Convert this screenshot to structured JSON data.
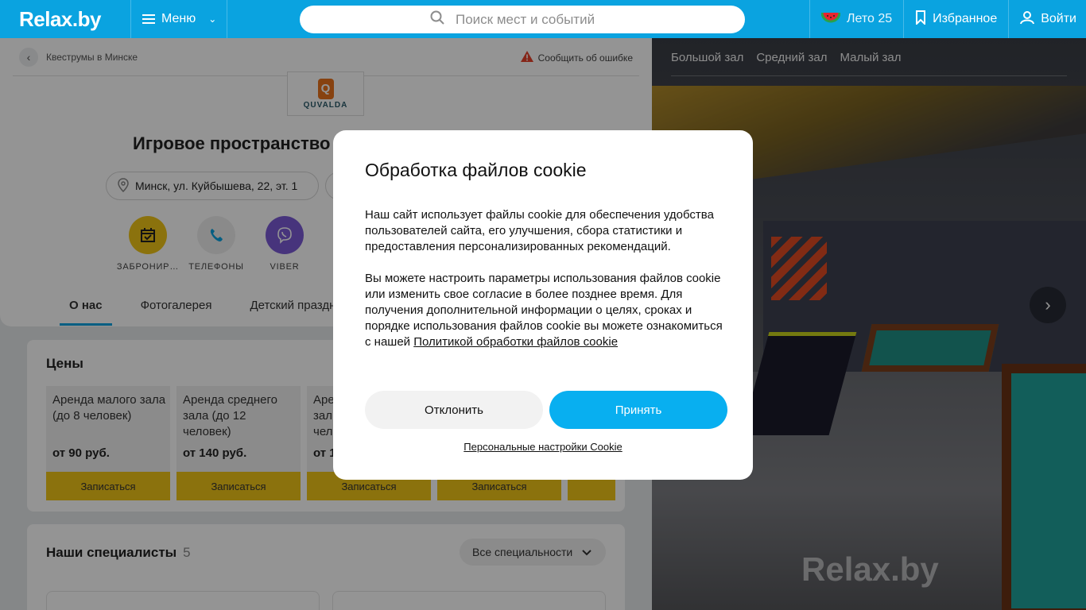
{
  "header": {
    "logo": "Relax.by",
    "menu_label": "Меню",
    "search_placeholder": "Поиск мест и событий",
    "summer_label": "Лето 25",
    "favorites_label": "Избранное",
    "login_label": "Войти"
  },
  "breadcrumb": {
    "back_text": "Квеструмы в Минске",
    "report_text": "Сообщить об ошибке"
  },
  "venue": {
    "logo_letter": "Q",
    "logo_text": "QUVALDA",
    "title": "Игровое пространство",
    "address": "Минск, ул. Куйбышева, 22, эт. 1",
    "actions": [
      {
        "label": "ЗАБРОНИР…"
      },
      {
        "label": "ТЕЛЕФОНЫ"
      },
      {
        "label": "VIBER"
      }
    ],
    "tabs": [
      {
        "label": "О нас"
      },
      {
        "label": "Фотогалерея"
      },
      {
        "label": "Детский праздник"
      }
    ]
  },
  "prices": {
    "title": "Цены",
    "items": [
      {
        "name": "Аренда малого зала (до 8 человек)",
        "price": "от 90 руб.",
        "button": "Записаться"
      },
      {
        "name": "Аренда среднего зала (до 12 человек)",
        "price": "от 140 руб.",
        "button": "Записаться"
      },
      {
        "name": "Аре зал чел",
        "price": "от 1",
        "button": "Записаться"
      },
      {
        "name": "",
        "price": "",
        "button": "Записаться"
      }
    ]
  },
  "specialists": {
    "title": "Наши специалисты",
    "count": "5",
    "filter": "Все специальности"
  },
  "gallery": {
    "tabs": [
      {
        "label": "Большой зал"
      },
      {
        "label": "Средний зал"
      },
      {
        "label": "Малый зал"
      }
    ],
    "watermark": "Relax.by"
  },
  "cookie_modal": {
    "title": "Обработка файлов cookie",
    "paragraph1": "Наш сайт использует файлы cookie для обеспечения удобства пользователей сайта, его улучшения, сбора статистики и предоставления персонализированных рекомендаций.",
    "paragraph2_text": "Вы можете настроить параметры использования файлов cookie или изменить свое согласие в более позднее время. Для получения дополнительной информации о целях, сроках и порядке использования файлов cookie вы можете ознакомиться с нашей ",
    "paragraph2_link": "Политикой обработки файлов cookie",
    "decline_label": "Отклонить",
    "accept_label": "Принять",
    "settings_link": "Персональные настройки Cookie"
  },
  "colors": {
    "brand": "#0aa3e0",
    "accept": "#08aff0",
    "book_button": "#f0c417",
    "viber": "#7b5bd6"
  }
}
